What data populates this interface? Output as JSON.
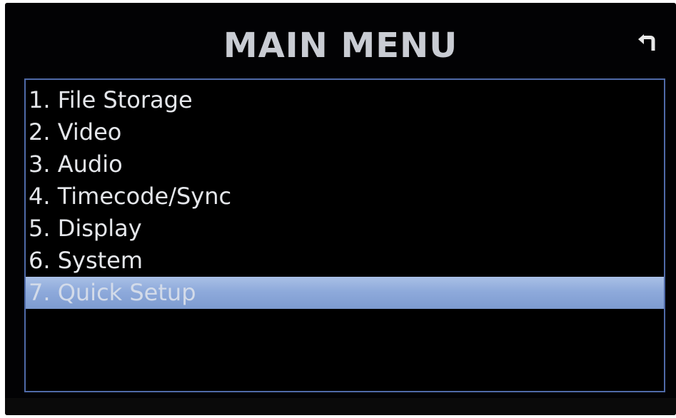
{
  "header": {
    "title": "MAIN MENU",
    "back_icon": "return-arrow-icon"
  },
  "menu": {
    "items": [
      {
        "label": "1. File Storage",
        "selected": false
      },
      {
        "label": "2. Video",
        "selected": false
      },
      {
        "label": "3. Audio",
        "selected": false
      },
      {
        "label": "4. Timecode/Sync",
        "selected": false
      },
      {
        "label": "5. Display",
        "selected": false
      },
      {
        "label": "6. System",
        "selected": false
      },
      {
        "label": "7. Quick Setup",
        "selected": true
      }
    ]
  },
  "colors": {
    "background": "#020204",
    "title_text": "#c9ccd3",
    "item_text": "#e4e6ea",
    "frame_border": "#4f6aa8",
    "selection_highlight": "#8eaadb"
  }
}
